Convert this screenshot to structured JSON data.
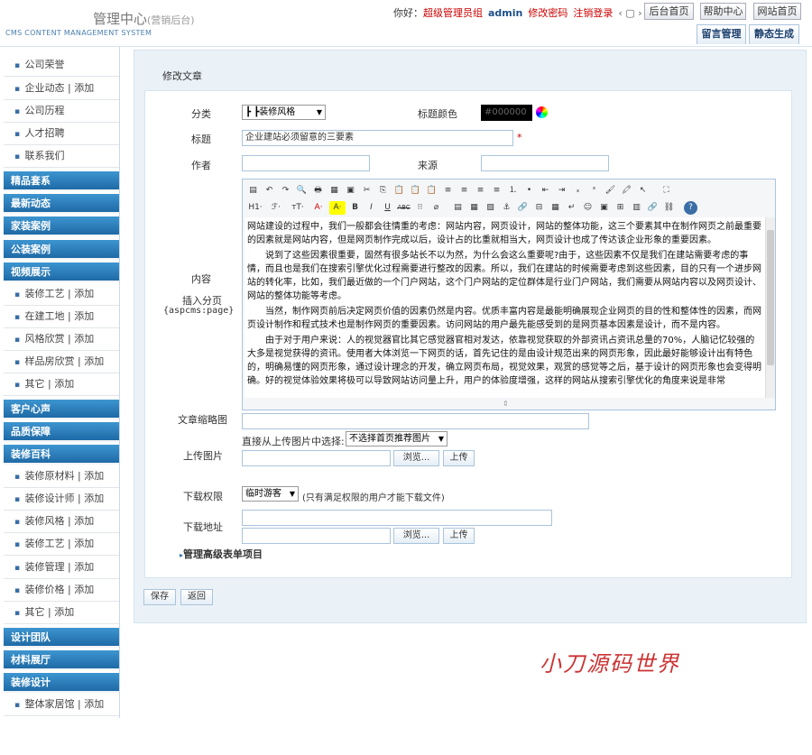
{
  "header": {
    "title": "管理中心",
    "title_sub": "(营销后台)",
    "subtitle": "CMS CONTENT MANAGEMENT SYSTEM",
    "hello": "你好：",
    "role": "超级管理员组",
    "user": "admin",
    "change_pwd": "修改密码",
    "logout": "注销登录",
    "nav_glyph": "‹ ▢ ›",
    "buttons": [
      "后台首页",
      "帮助中心",
      "网站首页"
    ],
    "tabs": [
      "留言管理",
      "静态生成"
    ]
  },
  "sidebar": {
    "items_top": [
      "公司荣誉",
      "企业动态 | 添加",
      "公司历程",
      "人才招聘",
      "联系我们"
    ],
    "heads": [
      "精品套系",
      "最新动态",
      "家装案例",
      "公装案例",
      "视频展示"
    ],
    "items_video": [
      "装修工艺 | 添加",
      "在建工地 | 添加",
      "风格欣赏 | 添加",
      "样品房欣赏 | 添加",
      "其它 | 添加"
    ],
    "heads2": [
      "客户心声",
      "品质保障",
      "装修百科"
    ],
    "items_baike": [
      "装修原材料 | 添加",
      "装修设计师 | 添加",
      "装修风格 | 添加",
      "装修工艺 | 添加",
      "装修管理 | 添加",
      "装修价格 | 添加",
      "其它 | 添加"
    ],
    "heads3": [
      "设计团队",
      "材料展厅",
      "装修设计"
    ],
    "items_last": [
      "整体家居馆 | 添加"
    ]
  },
  "form": {
    "heading": "修改文章",
    "category_label": "分类",
    "category_value": "┣ ┣装修风格",
    "title_color_label": "标题颜色",
    "title_color_value": "#000000",
    "title_label": "标题",
    "title_value": "企业建站必须留意的三要素",
    "required_mark": "*",
    "author_label": "作者",
    "source_label": "来源",
    "content_label": "内容",
    "insert_page_label": "插入分页",
    "insert_page_code": "{aspcms:page}",
    "thumb_label": "文章缩略图",
    "upload_label": "上传图片",
    "pick_label": "直接从上传图片中选择:",
    "pick_value": "不选择首页推荐图片",
    "browse": "浏览...",
    "upload": "上传",
    "perm_label": "下载权限",
    "perm_value": "临时游客",
    "perm_note": "(只有满足权限的用户才能下载文件)",
    "download_label": "下载地址",
    "advanced": "管理高级表单项目",
    "save": "保存",
    "back": "返回"
  },
  "editor": {
    "toolbar1": [
      "▤",
      "↶",
      "↷",
      "🔍",
      "🖶",
      "▦",
      "▣",
      "✂",
      "⎘",
      "📋",
      "📋",
      "📋",
      "≡",
      "≡",
      "≡",
      "≡",
      "⒈",
      "•",
      "⇤",
      "⇥",
      "ₓ",
      "ˣ",
      "🖌",
      "🖍",
      "↖",
      "⛶"
    ],
    "toolbar2": [
      "H1·",
      "ℱ·",
      "тT·",
      "A·",
      "A·",
      "B",
      "I",
      "U",
      "ABC",
      "⁝⁝",
      "⌀",
      "▤",
      "▦",
      "▧",
      "⚓",
      "🔗",
      "⊟",
      "▦",
      "↵",
      "☺",
      "▣",
      "⊞",
      "▥",
      "🔗",
      "⛓",
      "?"
    ],
    "p1": "网站建设的过程中，我们一般都会往情重的考虑：网站内容，网页设计，网站的整体功能，这三个要素其中在制作网页之前最重要的因素就是网站内容，但是网页制作完成以后，设计占的比重就相当大，网页设计也成了传达该企业形象的重要因素。",
    "p2": "说到了这些因素很重要，固然有很多站长不以为然，为什么会这么重要呢?由于，这些因素不仅是我们在建站需要考虑的事情，而且也是我们在搜索引擎优化过程需要进行整改的因素。所以，我们在建站的时候需要考虑到这些因素，目的只有一个进步网站的转化率，比如，我们最近做的一个门户网站，这个门户网站的定位群体是行业门户网站，我们需要从网站内容以及网页设计、网站的整体功能等考虑。",
    "p3": "当然，制作网页前后决定网页价值的因素仍然是内容。优质丰富内容是最能明确展现企业网页的目的性和整体性的因素，而网页设计制作和程式技术也是制作网页的重要因素。访问网站的用户最先能感受到的是网页基本因素是设计，而不是内容。",
    "p4": "由于对于用户来说：人的视觉器官比其它感觉器官相对发达，依靠视觉获取的外部资讯占资讯总量的70%，人脑记忆较强的大多是视觉获得的资讯。使用者大体浏览一下网页的话，首先记住的是由设计规范出来的网页形象，因此最好能够设计出有特色的，明确易懂的网页形象，通过设计理念的开发，确立网页布局，视觉效果，观赏的感觉等之后，基于设计的网页形象也会变得明确。好的视觉体验效果将极可以导致网站访问量上升，用户的体验度增强，这样的网站从搜索引擎优化的角度来说是非常"
  },
  "watermark": "小刀源码世界",
  "colors": {
    "accent": "#1f6aa6",
    "red": "#c00",
    "panel_bg": "#eaf2f8"
  }
}
